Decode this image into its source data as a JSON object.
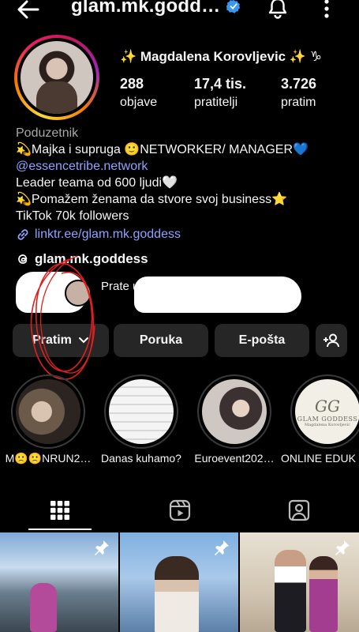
{
  "header": {
    "handle": "glam.mk.godd…"
  },
  "profile": {
    "display_name": "✨ Magdalena Korovljevic ✨ ♑",
    "stats": [
      {
        "value": "288",
        "label": "objave"
      },
      {
        "value": "17,4 tis.",
        "label": "pratitelji"
      },
      {
        "value": "3.726",
        "label": "pratim"
      }
    ]
  },
  "bio": {
    "category": "Poduzetnik",
    "line1": "💫Majka i supruga 🙂NETWORKER/ MANAGER💙",
    "mention": "@essencetribe.network",
    "line2": "Leader teama od 600 ljudi🤍",
    "line3": "💫Pomažem ženama da stvore svoj business⭐",
    "line4": "TikTok 70k followers",
    "link": "linktr.ee/glam.mk.goddess"
  },
  "threads": {
    "label": "glam.mk.goddess"
  },
  "followed_by": {
    "text": "Prate u"
  },
  "actions": {
    "following": "Pratim",
    "message": "Poruka",
    "email": "E-pošta"
  },
  "highlights": [
    {
      "label": "M🙁🙁NRUN2…"
    },
    {
      "label": "Danas kuhamo?"
    },
    {
      "label": "Euroevent202…"
    },
    {
      "label": "ONLINE EDUK"
    }
  ],
  "highlight_logo": {
    "line1": "GG",
    "line2": "GLAM GODDESS",
    "line3": "Magdalena Korovljevic"
  },
  "colors": {
    "background": "#000000",
    "button": "#262626",
    "link": "#8fa2ff",
    "verified": "#3897f0",
    "annotation_red": "#e02020"
  },
  "icons": {
    "back": "arrow-left-icon",
    "verified": "verified-badge-icon",
    "bell": "bell-icon",
    "more": "more-vertical-icon",
    "link": "link-icon",
    "threads": "threads-icon",
    "add_person": "add-person-icon",
    "grid": "grid-icon",
    "reels": "reels-icon",
    "tagged": "tagged-icon",
    "pin": "pin-icon"
  }
}
